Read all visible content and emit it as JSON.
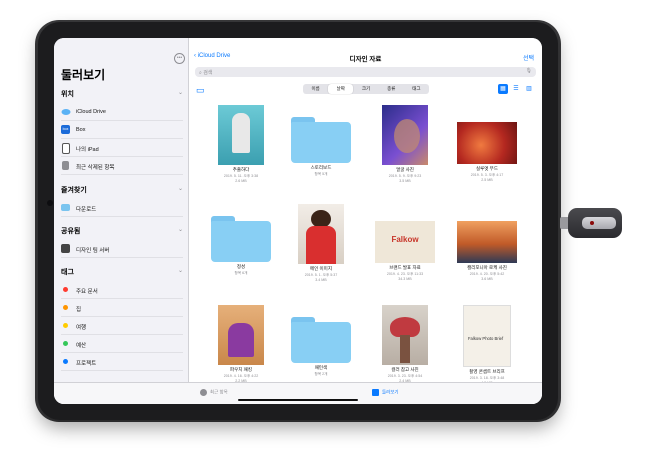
{
  "status": {
    "time": "오전 9:41 6월 16일 화요일",
    "right": "100%"
  },
  "sidebar": {
    "title": "둘러보기",
    "sections": [
      {
        "label": "위치",
        "items": [
          {
            "label": "iCloud Drive",
            "icon": "cloud-icon",
            "color": "#5ab2f5"
          },
          {
            "label": "Box",
            "icon": "box-icon",
            "color": "#1b6bd9"
          },
          {
            "label": "나의 iPad",
            "icon": "ipad-icon",
            "color": "#555555"
          },
          {
            "label": "최근 삭제된 항목",
            "icon": "trash-icon",
            "color": "#777777"
          }
        ]
      },
      {
        "label": "즐겨찾기",
        "items": [
          {
            "label": "다운로드",
            "icon": "folder-icon",
            "color": "#7ac4ef"
          }
        ]
      },
      {
        "label": "공유됨",
        "items": [
          {
            "label": "디자인 팀 서버",
            "icon": "server-icon",
            "color": "#444444"
          }
        ]
      },
      {
        "label": "태그",
        "items": [
          {
            "label": "주요 문서",
            "color": "#ff3b30"
          },
          {
            "label": "집",
            "color": "#ff9500"
          },
          {
            "label": "여행",
            "color": "#ffcc00"
          },
          {
            "label": "예산",
            "color": "#34c759"
          },
          {
            "label": "프로젝트",
            "color": "#0a7aff"
          }
        ]
      }
    ]
  },
  "nav": {
    "back": "iCloud Drive",
    "title": "디자인 자료",
    "select": "선택"
  },
  "search": {
    "placeholder": "검색"
  },
  "sort": {
    "options": [
      "이름",
      "날짜",
      "크기",
      "종류",
      "태그"
    ],
    "active": 1
  },
  "files": [
    {
      "name": "추출하다",
      "date": "2019. 5. 11. 오후 3:38",
      "size": "2.6 MB",
      "kind": "photo",
      "bg": "#57b8c8"
    },
    {
      "name": "스토리보드",
      "date": "항목 5개",
      "size": "",
      "kind": "folder"
    },
    {
      "name": "얼굴 사진",
      "date": "2019. 5. 9. 오후 9:23",
      "size": "3.5 MB",
      "kind": "photo",
      "bg": "#4a3fb5"
    },
    {
      "name": "실루엣 무드",
      "date": "2019. 5. 3. 오후 4:17",
      "size": "2.5 MB",
      "kind": "photo",
      "bg": "#c8362a"
    },
    {
      "name": "정성",
      "date": "항목 6개",
      "size": "",
      "kind": "folder"
    },
    {
      "name": "메인 이미지",
      "date": "2019. 5. 1. 오후 5:37",
      "size": "3.4 MB",
      "kind": "photo",
      "bg": "#d92f2f"
    },
    {
      "name": "브랜드 발표 자료",
      "date": "2019. 4. 23. 오후 11:33",
      "size": "34.3 MB",
      "kind": "doc",
      "bg": "#efe7d8",
      "label": "Falkow"
    },
    {
      "name": "캘리포니아 로케 사진",
      "date": "2019. 4. 20. 오후 5:42",
      "size": "3.6 MB",
      "kind": "photo",
      "bg": "#d9702a"
    },
    {
      "name": "파우치 패킹",
      "date": "2019. 4. 16. 오후 4:22",
      "size": "2.2 MB",
      "kind": "photo",
      "bg": "#8a3aa0"
    },
    {
      "name": "패턴색",
      "date": "항목 2개",
      "size": "",
      "kind": "folder"
    },
    {
      "name": "컬러 참고 사진",
      "date": "2019. 3. 23. 오후 4:54",
      "size": "2.4 MB",
      "kind": "photo",
      "bg": "#c03a40"
    },
    {
      "name": "촬영 콘셉트 브리프",
      "date": "2019. 3. 18. 오후 3:48",
      "size": "4.5 MB",
      "kind": "doc",
      "bg": "#f1ece2",
      "label": "Falkow Photo Brief"
    }
  ],
  "tabbar": {
    "recents": "최근 항목",
    "browse": "둘러보기"
  }
}
